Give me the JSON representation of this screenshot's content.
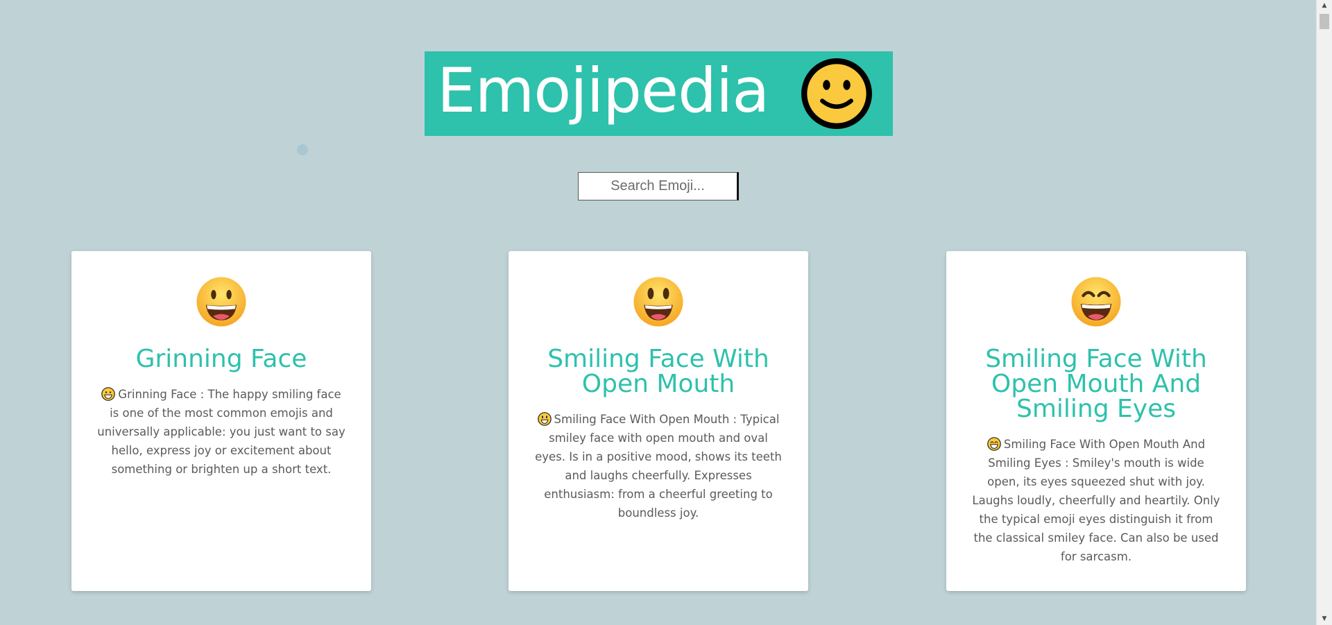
{
  "header": {
    "title": "Emojipedia",
    "logo_icon": "slightly-smiling-face-icon"
  },
  "search": {
    "placeholder": "Search Emoji..."
  },
  "cards": [
    {
      "icon": "grinning-face-emoji",
      "title": "Grinning Face",
      "description": "Grinning Face : The happy smiling face is one of the most common emojis and universally applicable: you just want to say hello, express joy or excitement about something or brighten up a short text."
    },
    {
      "icon": "smiling-face-with-open-mouth-emoji",
      "title": "Smiling Face With Open Mouth",
      "description": "Smiling Face With Open Mouth : Typical smiley face with open mouth and oval eyes. Is in a positive mood, shows its teeth and laughs cheerfully. Expresses enthusiasm: from a cheerful greeting to boundless joy."
    },
    {
      "icon": "smiling-face-with-open-mouth-and-smiling-eyes-emoji",
      "title": "Smiling Face With Open Mouth And Smiling Eyes",
      "description": "Smiling Face With Open Mouth And Smiling Eyes : Smiley's mouth is wide open, its eyes squeezed shut with joy. Laughs loudly, cheerfully and heartily. Only the typical emoji eyes distinguish it from the classical smiley face. Can also be used for sarcasm."
    }
  ],
  "colors": {
    "background": "#bfd3d6",
    "accent": "#2ec1ac",
    "card": "#ffffff",
    "body_text": "#5a5a5a"
  }
}
